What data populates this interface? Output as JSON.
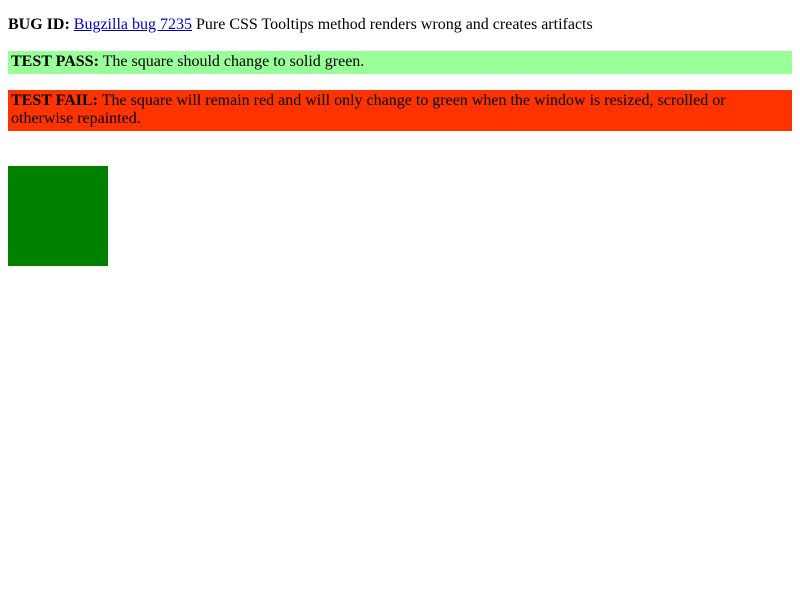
{
  "bug": {
    "id_label": "BUG ID:",
    "link_text": "Bugzilla bug 7235",
    "description": " Pure CSS Tooltips method renders wrong and creates artifacts"
  },
  "pass": {
    "label": "TEST PASS:",
    "text": " The square should change to solid green.",
    "color": "#99ff99"
  },
  "fail": {
    "label": "TEST FAIL:",
    "text": " The square will remain red and will only change to green when the window is resized, scrolled or otherwise repainted.",
    "color": "#ff3300"
  },
  "square": {
    "color": "#008000"
  }
}
